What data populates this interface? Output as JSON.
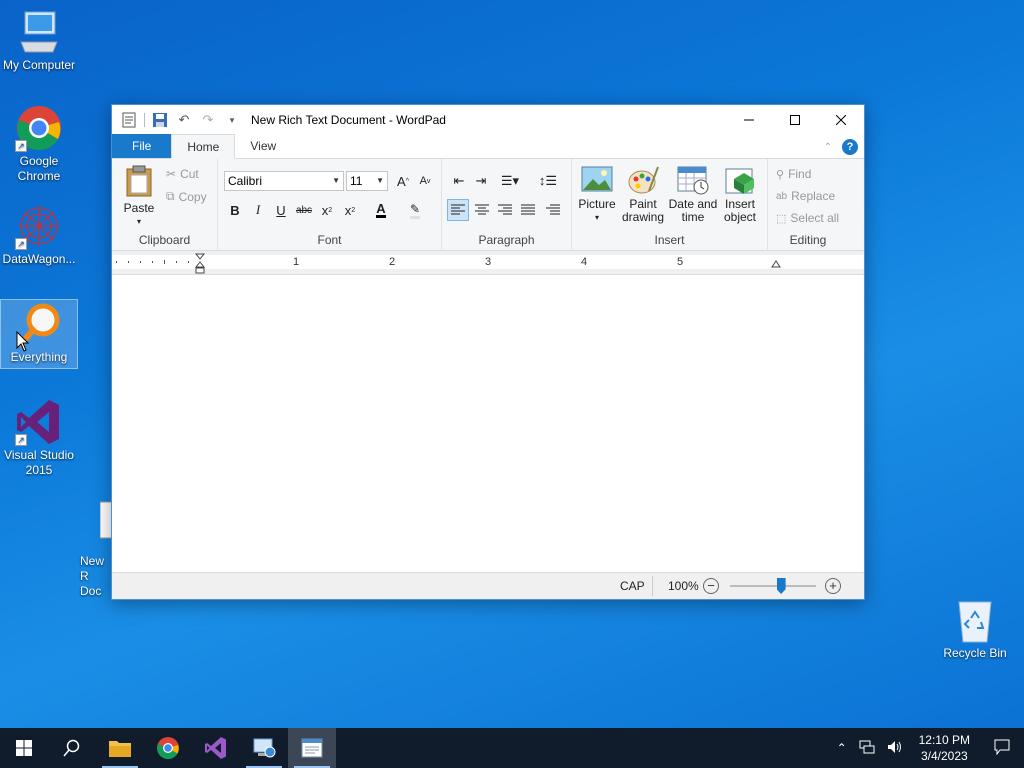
{
  "desktop": {
    "icons": [
      {
        "label": "My Computer"
      },
      {
        "label": "Google Chrome"
      },
      {
        "label": "DataWagon..."
      },
      {
        "label": "Everything"
      },
      {
        "label": "Visual Studio 2015"
      },
      {
        "label": "New R Doc"
      },
      {
        "label": "Recycle Bin"
      }
    ]
  },
  "window": {
    "title": "New Rich Text Document - WordPad",
    "tabs": [
      "File",
      "Home",
      "View"
    ],
    "ribbon": {
      "clipboard": {
        "label": "Clipboard",
        "paste": "Paste",
        "cut": "Cut",
        "copy": "Copy"
      },
      "font": {
        "label": "Font",
        "family": "Calibri",
        "size": "11"
      },
      "paragraph": {
        "label": "Paragraph"
      },
      "insert": {
        "label": "Insert",
        "picture": "Picture",
        "paint_line1": "Paint",
        "paint_line2": "drawing",
        "datetime_line1": "Date and",
        "datetime_line2": "time",
        "object_line1": "Insert",
        "object_line2": "object"
      },
      "editing": {
        "label": "Editing",
        "find": "Find",
        "replace": "Replace",
        "select_all": "Select all"
      }
    },
    "ruler": [
      "1",
      "2",
      "3",
      "4",
      "5"
    ],
    "status": {
      "caps": "CAP",
      "zoom": "100%",
      "zoom_level_percent": 100
    }
  },
  "taskbar": {
    "time": "12:10 PM",
    "date": "3/4/2023"
  },
  "colors": {
    "accent": "#1979ca",
    "taskbar": "#101c2b"
  }
}
